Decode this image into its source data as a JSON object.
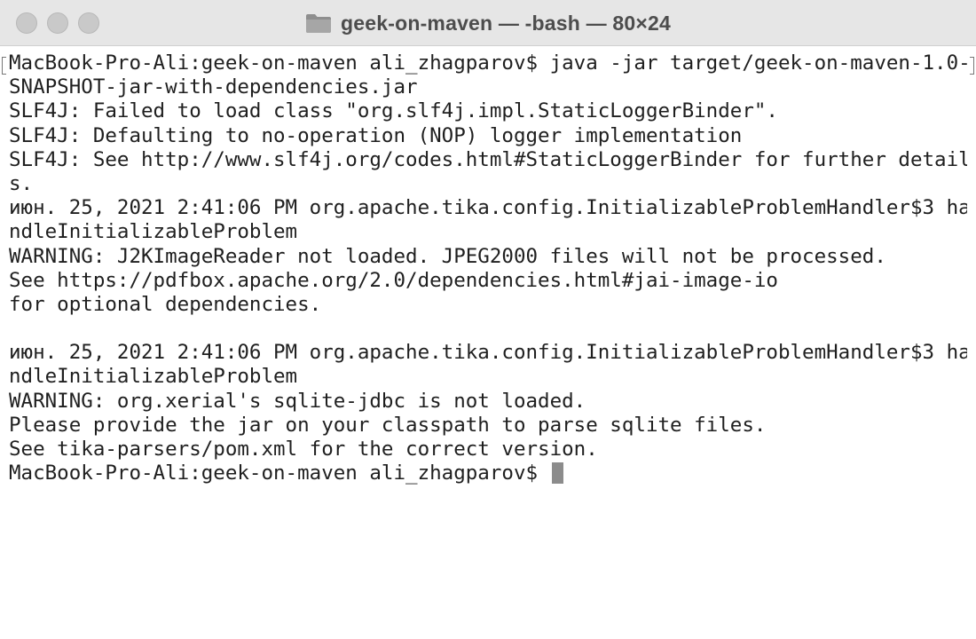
{
  "window": {
    "title": "geek-on-maven — -bash — 80×24",
    "title_icon": "folder-icon"
  },
  "terminal": {
    "lines": [
      "MacBook-Pro-Ali:geek-on-maven ali_zhagparov$ java -jar target/geek-on-maven-1.0-",
      "SNAPSHOT-jar-with-dependencies.jar",
      "SLF4J: Failed to load class \"org.slf4j.impl.StaticLoggerBinder\".",
      "SLF4J: Defaulting to no-operation (NOP) logger implementation",
      "SLF4J: See http://www.slf4j.org/codes.html#StaticLoggerBinder for further detail",
      "s.",
      "июн. 25, 2021 2:41:06 PM org.apache.tika.config.InitializableProblemHandler$3 ha",
      "ndleInitializableProblem",
      "WARNING: J2KImageReader not loaded. JPEG2000 files will not be processed.",
      "See https://pdfbox.apache.org/2.0/dependencies.html#jai-image-io",
      "for optional dependencies.",
      "",
      "июн. 25, 2021 2:41:06 PM org.apache.tika.config.InitializableProblemHandler$3 ha",
      "ndleInitializableProblem",
      "WARNING: org.xerial's sqlite-jdbc is not loaded.",
      "Please provide the jar on your classpath to parse sqlite files.",
      "See tika-parsers/pom.xml for the correct version."
    ],
    "prompt": "MacBook-Pro-Ali:geek-on-maven ali_zhagparov$ "
  },
  "colors": {
    "titlebar": "#e6e6e6",
    "traffic_lights": "#c9c9c9",
    "cursor": "#8c8c8c",
    "text": "#1f1f1f"
  }
}
